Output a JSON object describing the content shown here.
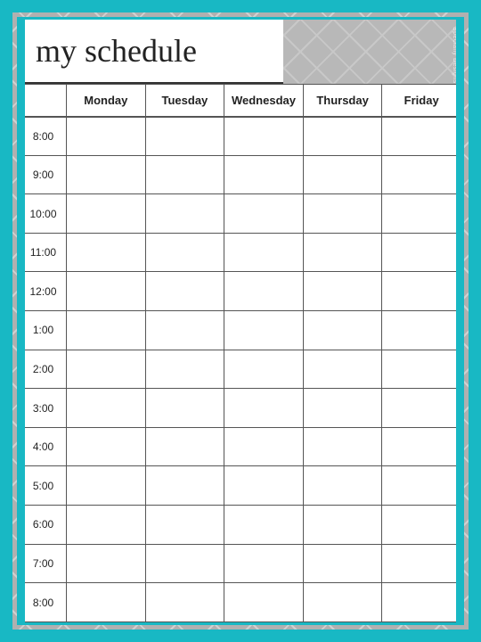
{
  "title": "my schedule",
  "watermark": "Specially Designs",
  "days": [
    "Monday",
    "Tuesday",
    "Wednesday",
    "Thursday",
    "Friday"
  ],
  "times": [
    "8:00",
    "9:00",
    "10:00",
    "11:00",
    "12:00",
    "1:00",
    "2:00",
    "3:00",
    "4:00",
    "5:00",
    "6:00",
    "7:00",
    "8:00"
  ]
}
